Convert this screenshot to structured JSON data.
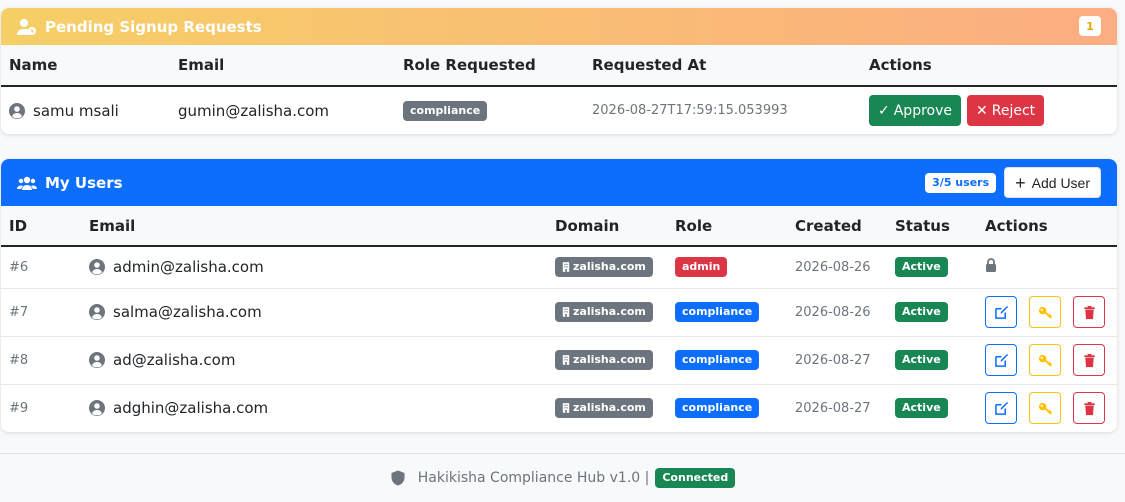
{
  "pending": {
    "title": "Pending Signup Requests",
    "count": "1",
    "columns": [
      "Name",
      "Email",
      "Role Requested",
      "Requested At",
      "Actions"
    ],
    "rows": [
      {
        "name": "samu msali",
        "email": "gumin@zalisha.com",
        "role": "compliance",
        "requested_at": "2026-08-27T17:59:15.053993"
      }
    ],
    "approve_label": "Approve",
    "reject_label": "Reject"
  },
  "users": {
    "title": "My Users",
    "count_badge": "3/5 users",
    "add_label": "Add User",
    "columns": [
      "ID",
      "Email",
      "Domain",
      "Role",
      "Created",
      "Status",
      "Actions"
    ],
    "rows": [
      {
        "id": "#6",
        "email": "admin@zalisha.com",
        "domain": "zalisha.com",
        "role": "admin",
        "created": "2026-08-26",
        "status": "Active",
        "locked": true
      },
      {
        "id": "#7",
        "email": "salma@zalisha.com",
        "domain": "zalisha.com",
        "role": "compliance",
        "created": "2026-08-26",
        "status": "Active",
        "locked": false
      },
      {
        "id": "#8",
        "email": "ad@zalisha.com",
        "domain": "zalisha.com",
        "role": "compliance",
        "created": "2026-08-27",
        "status": "Active",
        "locked": false
      },
      {
        "id": "#9",
        "email": "adghin@zalisha.com",
        "domain": "zalisha.com",
        "role": "compliance",
        "created": "2026-08-27",
        "status": "Active",
        "locked": false
      }
    ]
  },
  "footer": {
    "text": "Hakikisha Compliance Hub v1.0 |",
    "status": "Connected"
  },
  "colors": {
    "primary": "#0d6efd",
    "success": "#198754",
    "danger": "#dc3545",
    "warning": "#ffc107",
    "secondary": "#6c757d"
  },
  "icons": {
    "pending_header": "user-clock-icon",
    "users_header": "users-icon",
    "user": "user-circle-icon",
    "lock": "lock-icon",
    "edit": "edit-icon",
    "key": "key-icon",
    "delete": "trash-icon",
    "domain": "building-icon",
    "footer": "shield-icon"
  }
}
